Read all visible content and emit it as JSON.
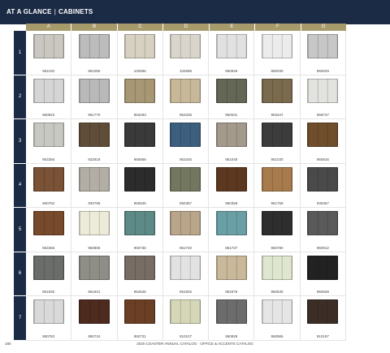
{
  "header": {
    "section": "AT A GLANCE",
    "divider": "|",
    "subsection": "CABINETS"
  },
  "columns": [
    "A",
    "B",
    "C",
    "D",
    "E",
    "F",
    "G"
  ],
  "rows": [
    {
      "label": "1",
      "items": [
        {
          "sku": "951100",
          "color": "#c9c7c0"
        },
        {
          "sku": "951050",
          "color": "#bcbcbc"
        },
        {
          "sku": "102595",
          "color": "#d6d1c0"
        },
        {
          "sku": "102596",
          "color": "#d9d5cc"
        },
        {
          "sku": "950949",
          "color": "#e1e1e1"
        },
        {
          "sku": "950030",
          "color": "#ececec"
        },
        {
          "sku": "950029",
          "color": "#c7c7c7"
        }
      ]
    },
    {
      "label": "2",
      "items": [
        {
          "sku": "950823",
          "color": "#d5d5d5"
        },
        {
          "sku": "951770",
          "color": "#b9b9b9"
        },
        {
          "sku": "953293",
          "color": "#a89774"
        },
        {
          "sku": "953336",
          "color": "#c8b89a"
        },
        {
          "sku": "950031",
          "color": "#646755"
        },
        {
          "sku": "953347",
          "color": "#7a6a4e"
        },
        {
          "sku": "958737",
          "color": "#e2e2de"
        }
      ]
    },
    {
      "label": "3",
      "items": [
        {
          "sku": "953356",
          "color": "#c8c8c2"
        },
        {
          "sku": "932819",
          "color": "#5f4d39"
        },
        {
          "sku": "950668",
          "color": "#3a3a3a"
        },
        {
          "sku": "953345",
          "color": "#3d5f7e"
        },
        {
          "sku": "951048",
          "color": "#a39a8c"
        },
        {
          "sku": "951030",
          "color": "#3c3c3c"
        },
        {
          "sku": "950816",
          "color": "#6f4e2c"
        }
      ]
    },
    {
      "label": "4",
      "items": [
        {
          "sku": "950762",
          "color": "#7a5236"
        },
        {
          "sku": "930795",
          "color": "#b3aea5"
        },
        {
          "sku": "950846",
          "color": "#2c2c2c"
        },
        {
          "sku": "950357",
          "color": "#73775f"
        },
        {
          "sku": "950358",
          "color": "#5c3820"
        },
        {
          "sku": "951758",
          "color": "#a87b4d"
        },
        {
          "sku": "930367",
          "color": "#4a4a4a"
        }
      ]
    },
    {
      "label": "5",
      "items": [
        {
          "sku": "953365",
          "color": "#784a2c"
        },
        {
          "sku": "950806",
          "color": "#ecead8"
        },
        {
          "sku": "950736",
          "color": "#5d8a86"
        },
        {
          "sku": "951740",
          "color": "#b8a58a"
        },
        {
          "sku": "951737",
          "color": "#6aa0a5"
        },
        {
          "sku": "950780",
          "color": "#2e2e2e"
        },
        {
          "sku": "950912",
          "color": "#5a5a5a"
        }
      ]
    },
    {
      "label": "6",
      "items": [
        {
          "sku": "951830",
          "color": "#6a6d6a"
        },
        {
          "sku": "951831",
          "color": "#8e8e86"
        },
        {
          "sku": "952845",
          "color": "#776d64"
        },
        {
          "sku": "951825",
          "color": "#e2e2e2"
        },
        {
          "sku": "953376",
          "color": "#c9b99a"
        },
        {
          "sku": "950630",
          "color": "#dfe6cf"
        },
        {
          "sku": "950639",
          "color": "#222222"
        }
      ]
    },
    {
      "label": "7",
      "items": [
        {
          "sku": "950783",
          "color": "#d9d9d9"
        },
        {
          "sku": "950724",
          "color": "#4d2b1e"
        },
        {
          "sku": "950731",
          "color": "#6b3f25"
        },
        {
          "sku": "910107",
          "color": "#d5d7b8"
        },
        {
          "sku": "950829",
          "color": "#6c6c6c"
        },
        {
          "sku": "950965",
          "color": "#e5e5e5"
        },
        {
          "sku": "910197",
          "color": "#3c2e27"
        }
      ]
    }
  ],
  "footer": {
    "page": "180",
    "catalog": "2020 COASTER ANNUAL CATALOG · OFFICE & ACCENTS CATALOG"
  }
}
